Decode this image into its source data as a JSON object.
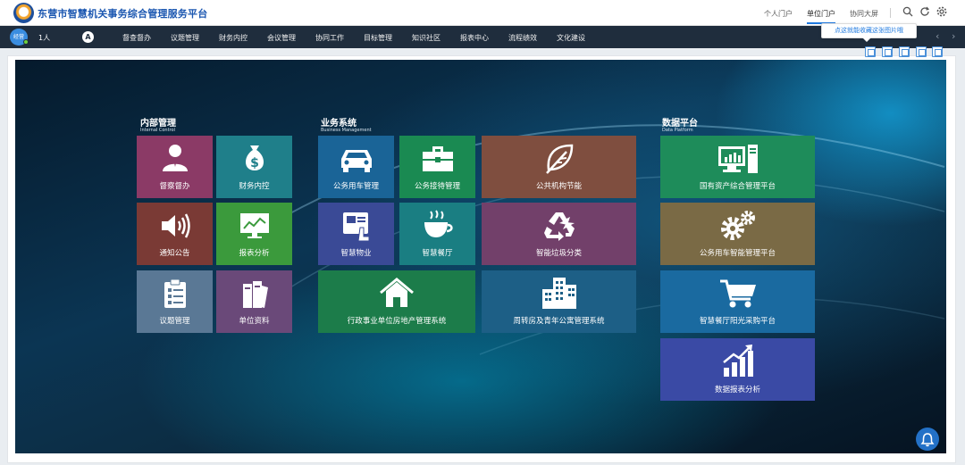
{
  "header": {
    "title": "东营市智慧机关事务综合管理服务平台",
    "nav": [
      "个人门户",
      "单位门户",
      "协同大屏"
    ],
    "active_nav": "单位门户"
  },
  "navbar": {
    "avatar_text": "经营",
    "user_count": "1人",
    "home_badge": "A",
    "items": [
      "督查督办",
      "议题管理",
      "财务内控",
      "会议管理",
      "协同工作",
      "目标管理",
      "知识社区",
      "报表中心",
      "流程绩效",
      "文化建设"
    ],
    "prev_arrow": "‹",
    "next_arrow": "›"
  },
  "tooltip": {
    "text": "点这就能收藏这张图片哦"
  },
  "sections": {
    "internal": {
      "title": "内部管理",
      "subtitle": "Internal Control"
    },
    "business": {
      "title": "业务系统",
      "subtitle": "Business Management"
    },
    "data": {
      "title": "数据平台",
      "subtitle": "Data Platform"
    }
  },
  "tiles": {
    "supervise": {
      "label": "督察督办",
      "color": "#8b3a66",
      "icon": "person-icon"
    },
    "finance": {
      "label": "财务内控",
      "color": "#1f7f8a",
      "icon": "money-bag-icon"
    },
    "notice": {
      "label": "通知公告",
      "color": "#7a3a35",
      "icon": "speaker-icon"
    },
    "report": {
      "label": "报表分析",
      "color": "#3b9a3c",
      "icon": "chart-monitor-icon"
    },
    "topic": {
      "label": "议题管理",
      "color": "#5a7895",
      "icon": "clipboard-icon"
    },
    "docs": {
      "label": "单位资料",
      "color": "#6a4979",
      "icon": "books-icon"
    },
    "car": {
      "label": "公务用车管理",
      "color": "#1a6497",
      "icon": "car-icon"
    },
    "reception": {
      "label": "公务接待管理",
      "color": "#1a8a52",
      "icon": "briefcase-icon"
    },
    "energy": {
      "label": "公共机构节能",
      "color": "#7f4e3f",
      "icon": "leaf-icon"
    },
    "property": {
      "label": "智慧物业",
      "color": "#3a4a96",
      "icon": "tablet-icon"
    },
    "canteen": {
      "label": "智慧餐厅",
      "color": "#1a7e82",
      "icon": "coffee-icon"
    },
    "garbage": {
      "label": "智能垃圾分类",
      "color": "#72406a",
      "icon": "recycle-icon"
    },
    "housing": {
      "label": "行政事业单位房地产管理系统",
      "color": "#1c7c4a",
      "icon": "house-icon"
    },
    "apartment": {
      "label": "周转房及青年公寓管理系统",
      "color": "#1d5f86",
      "icon": "buildings-icon"
    },
    "assets": {
      "label": "国有资产综合管理平台",
      "color": "#1e8c5a",
      "icon": "computer-icon"
    },
    "carplatform": {
      "label": "公务用车智能管理平台",
      "color": "#7a6a45",
      "icon": "gears-icon"
    },
    "purchase": {
      "label": "智慧餐厅阳光采购平台",
      "color": "#1a6aa0",
      "icon": "cart-icon"
    },
    "stats": {
      "label": "数据报表分析",
      "color": "#3a4aa5",
      "icon": "growth-chart-icon"
    }
  }
}
